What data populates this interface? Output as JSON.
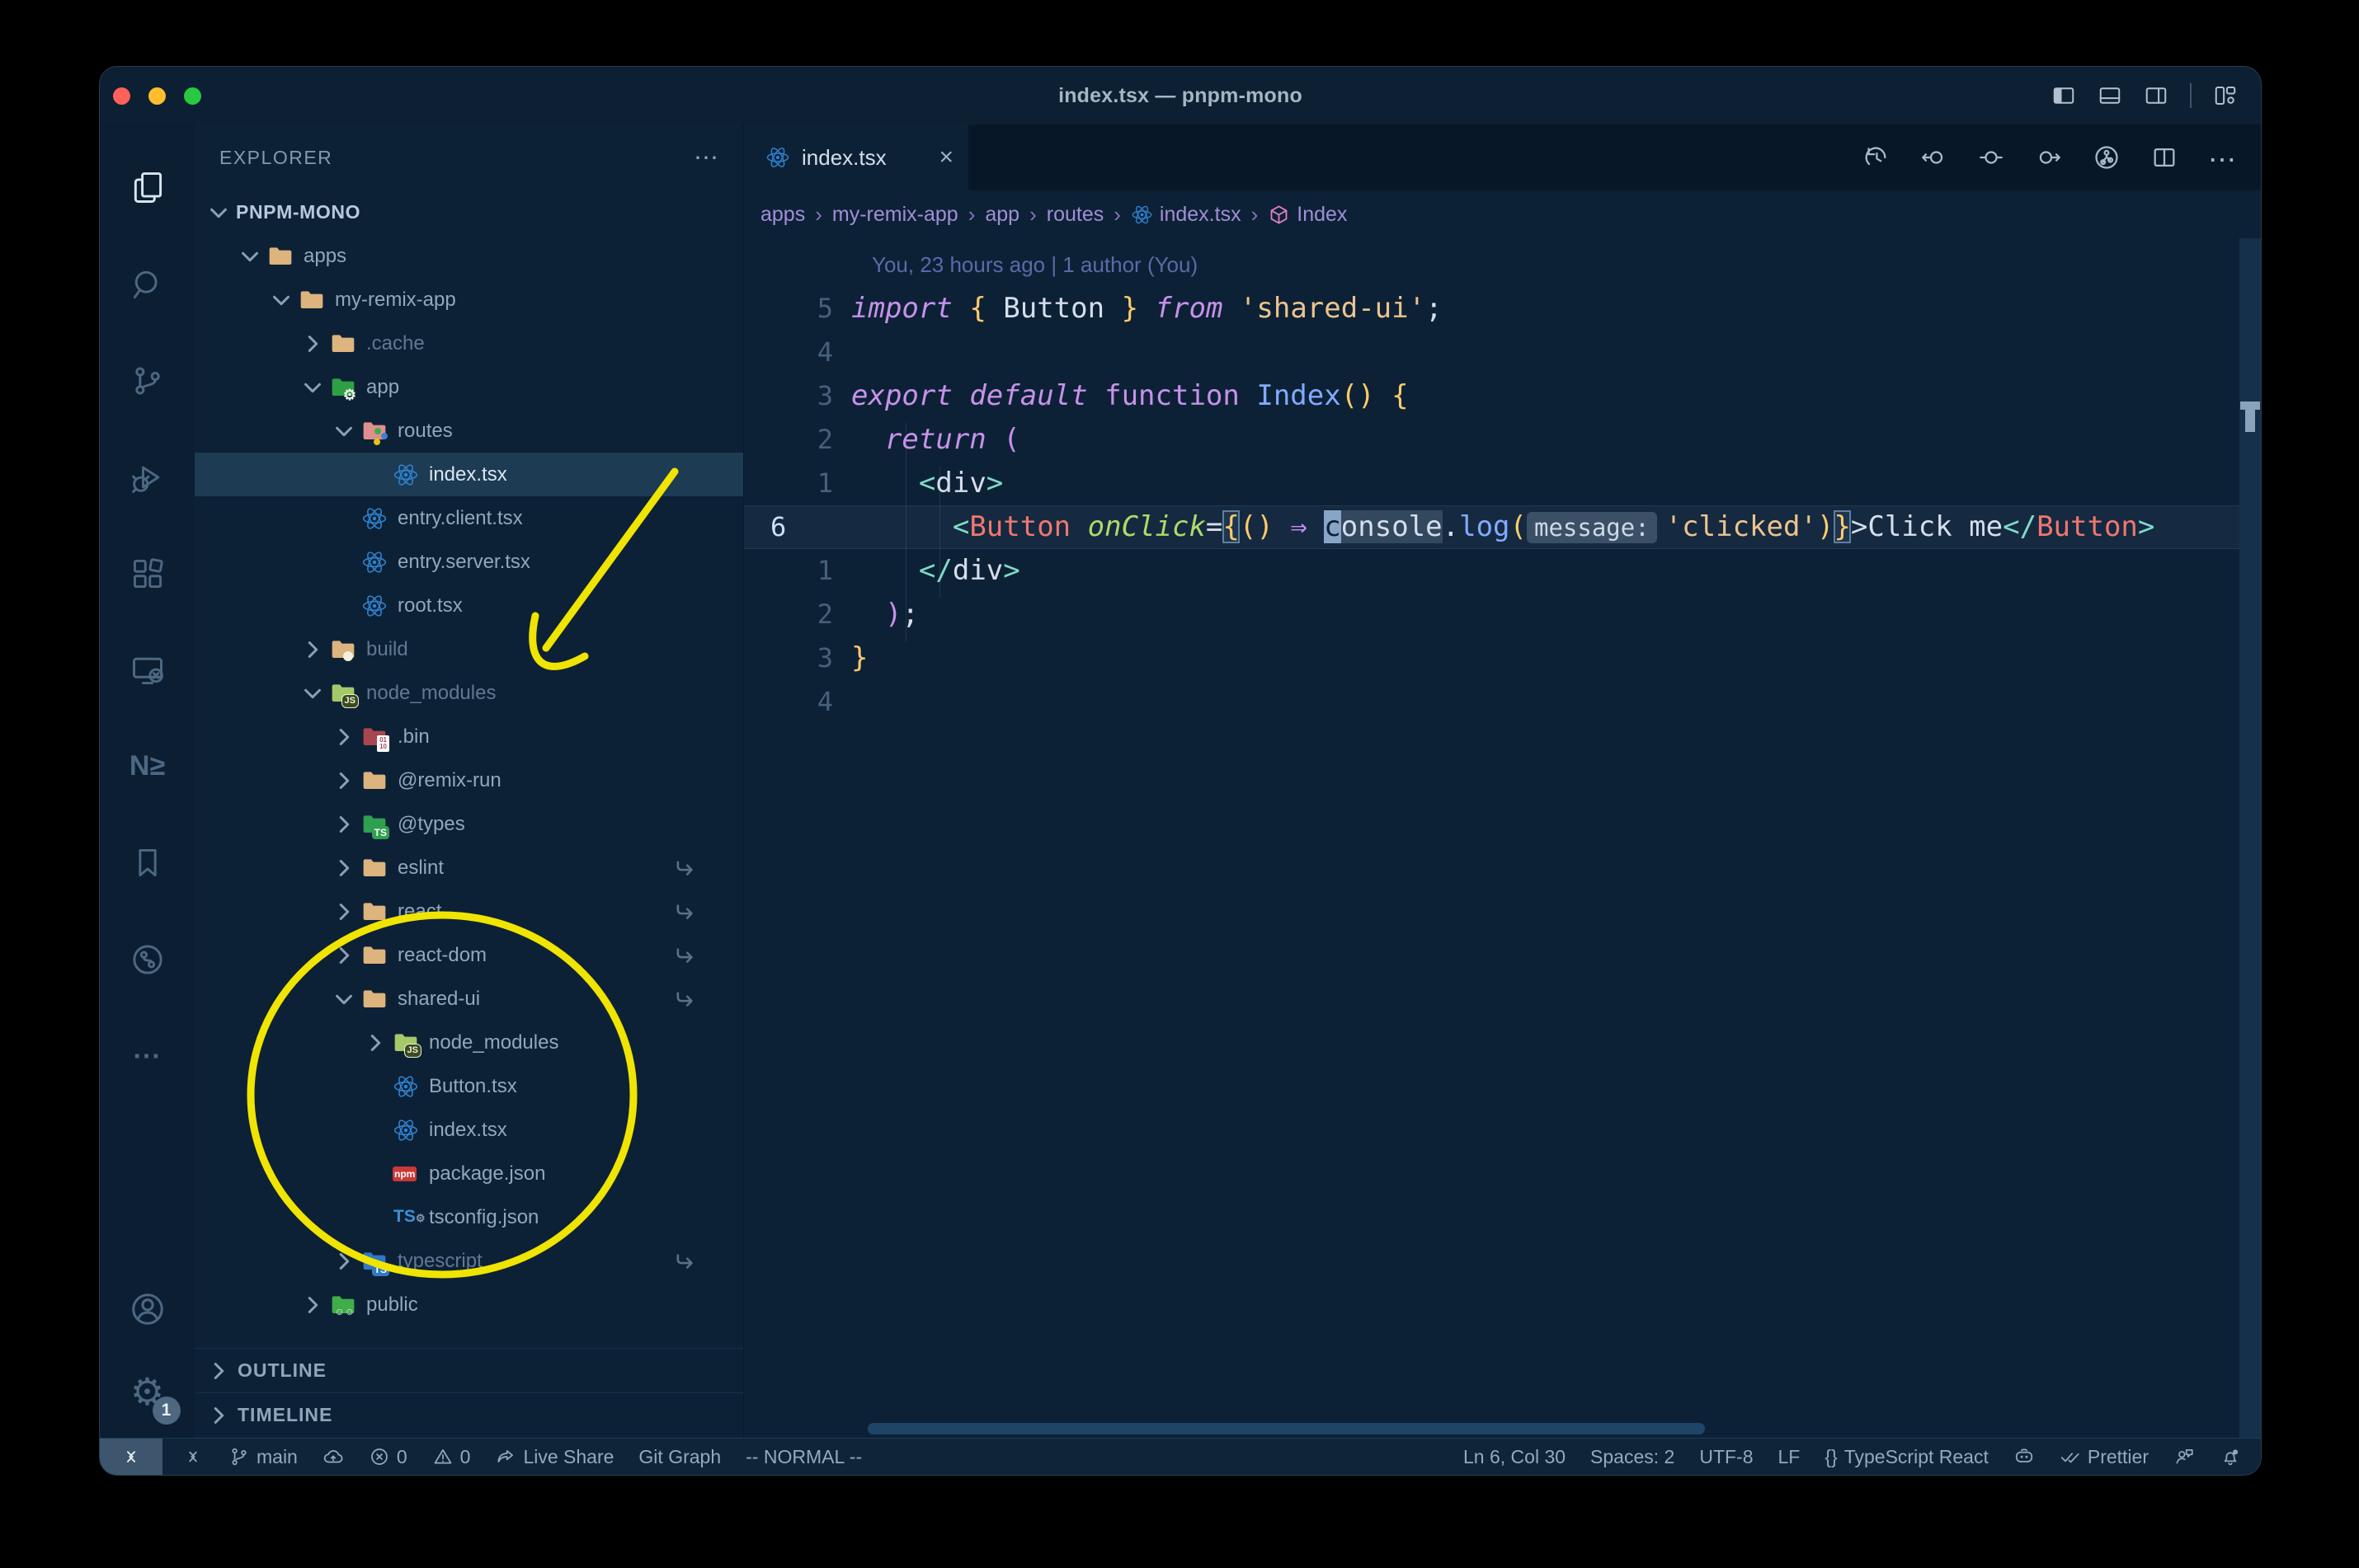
{
  "window": {
    "title": "index.tsx — pnpm-mono"
  },
  "titlebar": {
    "icons": [
      "panel-left",
      "panel-bottom",
      "panel-right",
      "sep",
      "layout-custom"
    ]
  },
  "activity_bar": {
    "top": [
      {
        "name": "explorer",
        "icon": "files",
        "active": true
      },
      {
        "name": "search",
        "icon": "search"
      },
      {
        "name": "source-control",
        "icon": "scm"
      },
      {
        "name": "run-debug",
        "icon": "debug"
      },
      {
        "name": "extensions",
        "icon": "ext"
      },
      {
        "name": "remote-explorer",
        "icon": "remote"
      },
      {
        "name": "nx-console",
        "icon": "nx"
      },
      {
        "name": "bookmarks",
        "icon": "bookmark"
      },
      {
        "name": "gitlens",
        "icon": "gitlens"
      },
      {
        "name": "more-views",
        "icon": "dots"
      }
    ],
    "bottom": [
      {
        "name": "accounts",
        "icon": "account"
      },
      {
        "name": "settings",
        "icon": "gear",
        "badge": "1"
      }
    ]
  },
  "explorer": {
    "header": "EXPLORER",
    "more": "⋯",
    "sections": [
      "OUTLINE",
      "TIMELINE"
    ],
    "tree": [
      {
        "label": "PNPM-MONO",
        "level": 0,
        "chevron": "down",
        "root": true
      },
      {
        "label": "apps",
        "level": 1,
        "chevron": "down",
        "icon": "folder"
      },
      {
        "label": "my-remix-app",
        "level": 2,
        "chevron": "down",
        "icon": "folder"
      },
      {
        "label": ".cache",
        "level": 3,
        "chevron": "right",
        "icon": "folder",
        "dim": true
      },
      {
        "label": "app",
        "level": 3,
        "chevron": "down",
        "icon": "folder-app"
      },
      {
        "label": "routes",
        "level": 4,
        "chevron": "down",
        "icon": "folder-routes"
      },
      {
        "label": "index.tsx",
        "level": 5,
        "icon": "react",
        "selected": true
      },
      {
        "label": "entry.client.tsx",
        "level": 4,
        "icon": "react"
      },
      {
        "label": "entry.server.tsx",
        "level": 4,
        "icon": "react"
      },
      {
        "label": "root.tsx",
        "level": 4,
        "icon": "react"
      },
      {
        "label": "build",
        "level": 3,
        "chevron": "right",
        "icon": "folder-build",
        "dim": true
      },
      {
        "label": "node_modules",
        "level": 3,
        "chevron": "down",
        "icon": "folder-node",
        "dim": true
      },
      {
        "label": ".bin",
        "level": 4,
        "chevron": "right",
        "icon": "folder-bin"
      },
      {
        "label": "@remix-run",
        "level": 4,
        "chevron": "right",
        "icon": "folder"
      },
      {
        "label": "@types",
        "level": 4,
        "chevron": "right",
        "icon": "folder-ts-green"
      },
      {
        "label": "eslint",
        "level": 4,
        "chevron": "right",
        "icon": "folder",
        "symlink": true
      },
      {
        "label": "react",
        "level": 4,
        "chevron": "right",
        "icon": "folder",
        "symlink": true
      },
      {
        "label": "react-dom",
        "level": 4,
        "chevron": "right",
        "icon": "folder",
        "symlink": true
      },
      {
        "label": "shared-ui",
        "level": 4,
        "chevron": "down",
        "icon": "folder",
        "symlink": true
      },
      {
        "label": "node_modules",
        "level": 5,
        "chevron": "right",
        "icon": "folder-node"
      },
      {
        "label": "Button.tsx",
        "level": 5,
        "icon": "react"
      },
      {
        "label": "index.tsx",
        "level": 5,
        "icon": "react"
      },
      {
        "label": "package.json",
        "level": 5,
        "icon": "npm"
      },
      {
        "label": "tsconfig.json",
        "level": 5,
        "icon": "ts-gear"
      },
      {
        "label": "typescript",
        "level": 4,
        "chevron": "right",
        "icon": "folder-ts-blue",
        "dim": true,
        "symlink": true
      },
      {
        "label": "public",
        "level": 3,
        "chevron": "right",
        "icon": "folder-public"
      }
    ]
  },
  "tab": {
    "label": "index.tsx",
    "icon": "react",
    "close": "×"
  },
  "editor_toolbar": [
    "history",
    "nav-back",
    "nav-circle",
    "nav-forward",
    "branch-circle",
    "split",
    "more"
  ],
  "breadcrumbs": [
    {
      "label": "apps"
    },
    {
      "label": "my-remix-app"
    },
    {
      "label": "app"
    },
    {
      "label": "routes"
    },
    {
      "label": "index.tsx",
      "icon": "react"
    },
    {
      "label": "Index",
      "icon": "symbol-box"
    }
  ],
  "editor": {
    "blame": "You, 23 hours ago | 1 author (You)",
    "lines": [
      {
        "gutter": "5",
        "tokens": [
          [
            "k",
            "import"
          ],
          [
            "w",
            " "
          ],
          [
            "p",
            "{"
          ],
          [
            "w",
            " Button "
          ],
          [
            "p",
            "}"
          ],
          [
            "w",
            " "
          ],
          [
            "k",
            "from"
          ],
          [
            "w",
            " "
          ],
          [
            "s",
            "'shared-ui'"
          ],
          [
            "w",
            ";"
          ]
        ]
      },
      {
        "gutter": "4",
        "tokens": []
      },
      {
        "gutter": "3",
        "tokens": [
          [
            "k",
            "export"
          ],
          [
            "w",
            " "
          ],
          [
            "k",
            "default"
          ],
          [
            "w",
            " "
          ],
          [
            "k2",
            "function"
          ],
          [
            "w",
            " "
          ],
          [
            "f",
            "Index"
          ],
          [
            "p",
            "()"
          ],
          [
            "w",
            " "
          ],
          [
            "p",
            "{"
          ]
        ]
      },
      {
        "gutter": "2",
        "tokens": [
          [
            "w",
            "  "
          ],
          [
            "k",
            "return"
          ],
          [
            "w",
            " "
          ],
          [
            "pk",
            "("
          ]
        ]
      },
      {
        "gutter": "1",
        "tokens": [
          [
            "w",
            "    "
          ],
          [
            "t",
            "<"
          ],
          [
            "w",
            "div"
          ],
          [
            "t",
            ">"
          ]
        ]
      },
      {
        "gutter": "6",
        "current": true,
        "tokens": [
          [
            "w",
            "      "
          ],
          [
            "t",
            "<"
          ],
          [
            "c",
            "Button"
          ],
          [
            "w",
            " "
          ],
          [
            "a",
            "onClick"
          ],
          [
            "w",
            "="
          ],
          [
            "box",
            "{"
          ],
          [
            "p",
            "()"
          ],
          [
            "w",
            " "
          ],
          [
            "arw",
            "⇒"
          ],
          [
            "w",
            " "
          ],
          [
            "cur",
            "c"
          ],
          [
            "hl",
            "onsole"
          ],
          [
            "w",
            "."
          ],
          [
            "f",
            "log"
          ],
          [
            "p",
            "("
          ],
          [
            "hint",
            "message:"
          ],
          [
            "s",
            "'clicked'"
          ],
          [
            "p",
            ")"
          ],
          [
            "box",
            "}"
          ],
          [
            "w",
            ">Click me"
          ],
          [
            "t",
            "</"
          ],
          [
            "c",
            "Button"
          ],
          [
            "t",
            ">"
          ]
        ]
      },
      {
        "gutter": "1",
        "tokens": [
          [
            "w",
            "    "
          ],
          [
            "t",
            "</"
          ],
          [
            "w",
            "div"
          ],
          [
            "t",
            ">"
          ]
        ]
      },
      {
        "gutter": "2",
        "tokens": [
          [
            "w",
            "  "
          ],
          [
            "pk",
            ")"
          ],
          [
            "w",
            ";"
          ]
        ]
      },
      {
        "gutter": "3",
        "tokens": [
          [
            "p",
            "}"
          ]
        ]
      },
      {
        "gutter": "4",
        "tokens": []
      }
    ]
  },
  "statusbar": {
    "left": [
      {
        "name": "remote-indicator",
        "icon": "remote-sb"
      },
      {
        "name": "git-branch",
        "icon": "branch",
        "text": "main"
      },
      {
        "name": "publish",
        "icon": "cloud"
      },
      {
        "name": "errors",
        "icon": "error",
        "text": "0"
      },
      {
        "name": "warnings",
        "icon": "warning",
        "text": "0"
      },
      {
        "name": "live-share",
        "icon": "share",
        "text": "Live Share"
      },
      {
        "name": "git-graph",
        "text": "Git Graph"
      },
      {
        "name": "vim-mode",
        "text": "-- NORMAL --"
      }
    ],
    "right": [
      {
        "name": "cursor-position",
        "text": "Ln 6, Col 30"
      },
      {
        "name": "indentation",
        "text": "Spaces: 2"
      },
      {
        "name": "encoding",
        "text": "UTF-8"
      },
      {
        "name": "eol",
        "text": "LF"
      },
      {
        "name": "language-mode",
        "icon": "braces",
        "text": "TypeScript React"
      },
      {
        "name": "copilot",
        "icon": "copilot"
      },
      {
        "name": "formatter",
        "icon": "checks",
        "text": "Prettier"
      },
      {
        "name": "feedback",
        "icon": "feedback"
      },
      {
        "name": "notifications",
        "icon": "bell"
      }
    ]
  },
  "annotations": {
    "color": "#f0e403"
  }
}
